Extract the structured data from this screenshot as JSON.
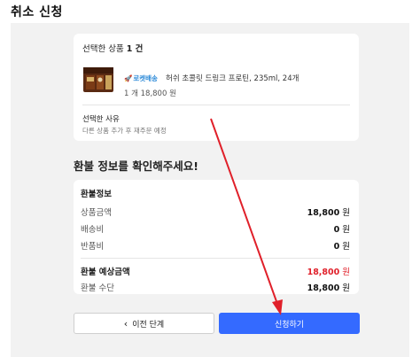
{
  "page": {
    "title": "취소 신청"
  },
  "selection": {
    "label": "선택한 상품",
    "count": "1 건",
    "product": {
      "badge": "로켓배송",
      "name": "허쉬 초콜릿 드링크 프로틴, 235ml, 24개",
      "qty_price": "1 개   18,800 원"
    },
    "reason_label": "선택한 사유",
    "reason_text": "다른 상품 추가 후 재주문 예정"
  },
  "refund": {
    "section_title": "환불 정보를 확인해주세요!",
    "header": "환불정보",
    "rows": [
      {
        "label": "상품금액",
        "value": "18,800",
        "unit": "원"
      },
      {
        "label": "배송비",
        "value": "0",
        "unit": "원"
      },
      {
        "label": "반품비",
        "value": "0",
        "unit": "원"
      }
    ],
    "expected": {
      "label": "환불 예상금액",
      "value": "18,800",
      "unit": "원",
      "color": "#e0202a"
    },
    "method": {
      "label": "환불 수단",
      "value": "18,800",
      "unit": "원"
    }
  },
  "buttons": {
    "prev": "이전 단계",
    "apply": "신청하기",
    "apply_color": "#346aff"
  },
  "annotation": {
    "color": "#e0202a"
  }
}
